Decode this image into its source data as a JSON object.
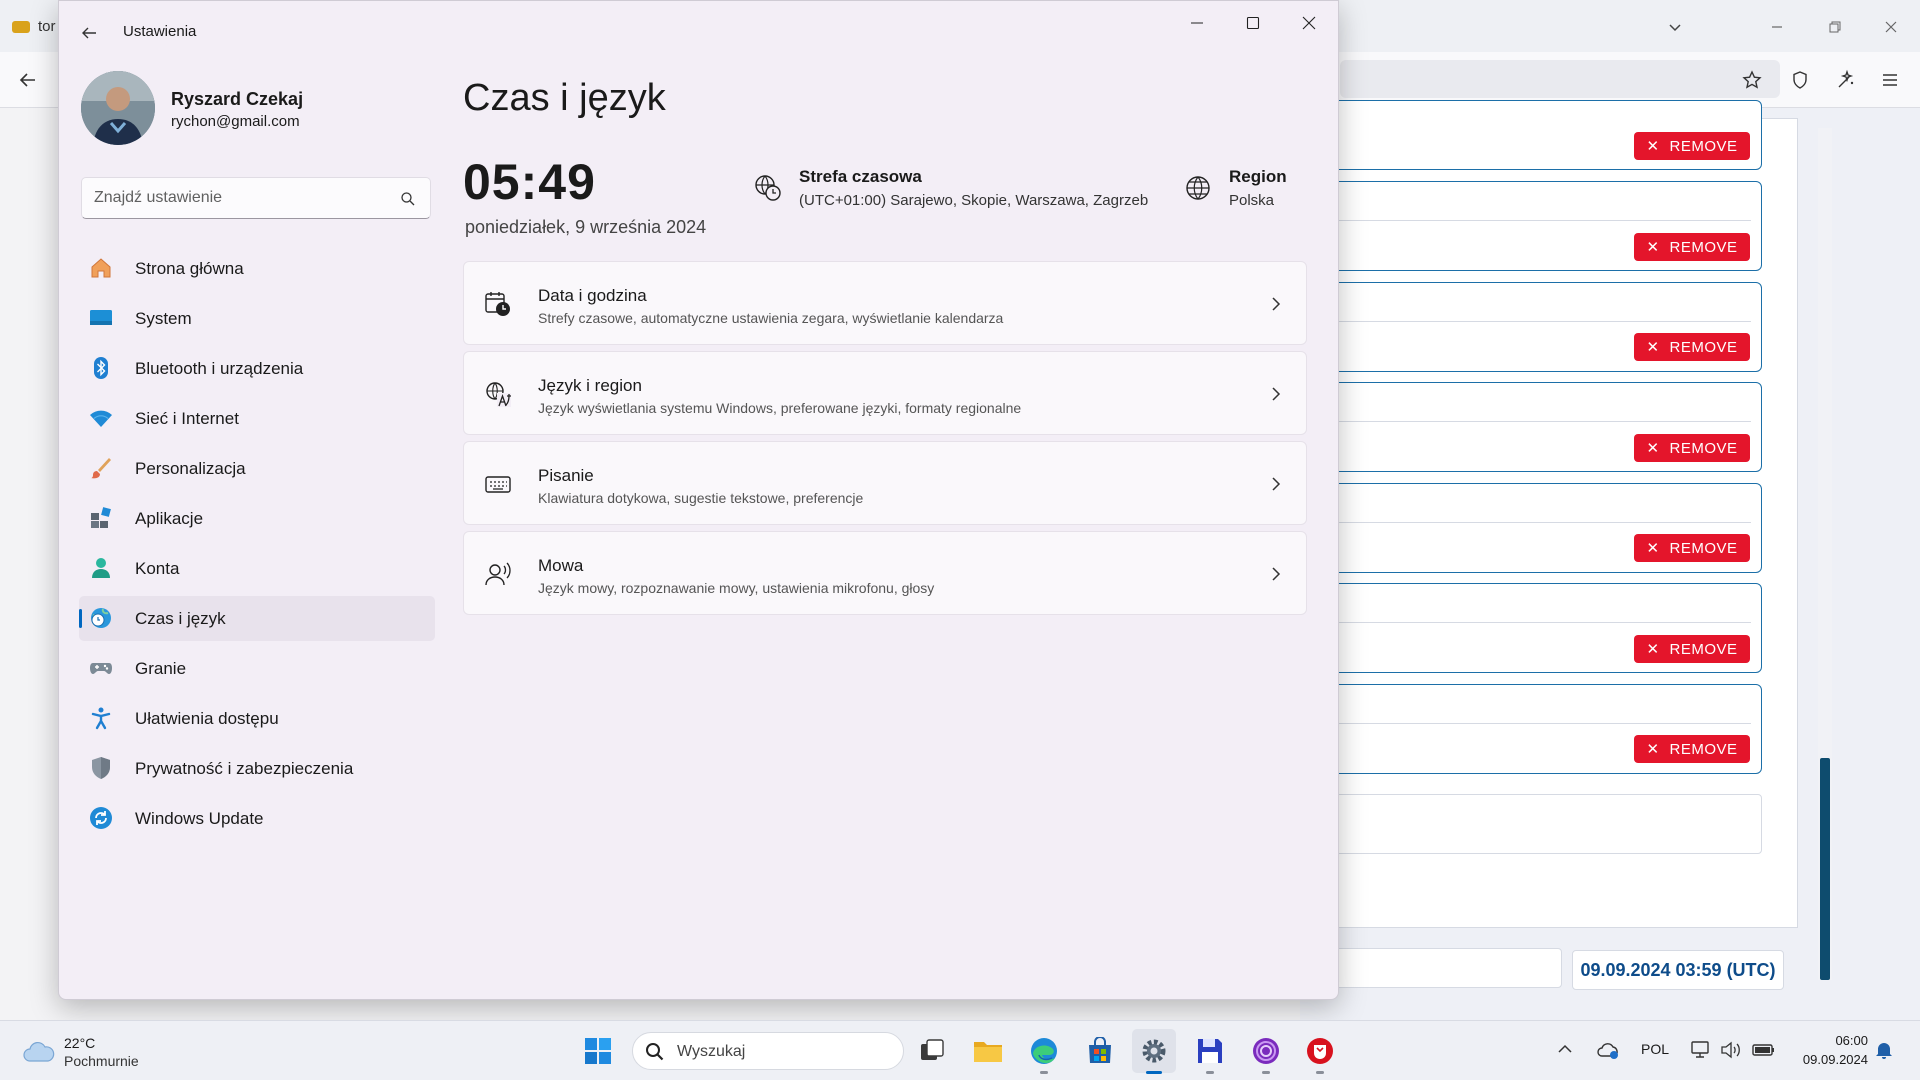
{
  "browser": {
    "tab_title": "tor",
    "remove_label": "REMOVE",
    "timestamp": "09.09.2024 03:59 (UTC)"
  },
  "settings": {
    "window_title": "Ustawienia",
    "user": {
      "name": "Ryszard Czekaj",
      "email": "rychon@gmail.com"
    },
    "search_placeholder": "Znajdź ustawienie",
    "nav": [
      {
        "label": "Strona główna",
        "icon": "home-icon",
        "active": false
      },
      {
        "label": "System",
        "icon": "monitor-icon",
        "active": false
      },
      {
        "label": "Bluetooth i urządzenia",
        "icon": "bluetooth-icon",
        "active": false
      },
      {
        "label": "Sieć i Internet",
        "icon": "wifi-icon",
        "active": false
      },
      {
        "label": "Personalizacja",
        "icon": "brush-icon",
        "active": false
      },
      {
        "label": "Aplikacje",
        "icon": "apps-icon",
        "active": false
      },
      {
        "label": "Konta",
        "icon": "person-icon",
        "active": false
      },
      {
        "label": "Czas i język",
        "icon": "globe-clock-icon",
        "active": true
      },
      {
        "label": "Granie",
        "icon": "gamepad-icon",
        "active": false
      },
      {
        "label": "Ułatwienia dostępu",
        "icon": "accessibility-icon",
        "active": false
      },
      {
        "label": "Prywatność i zabezpieczenia",
        "icon": "shield-icon",
        "active": false
      },
      {
        "label": "Windows Update",
        "icon": "update-icon",
        "active": false
      }
    ],
    "page_title": "Czas i język",
    "clock": "05:49",
    "date": "poniedziałek, 9 września 2024",
    "timezone": {
      "title": "Strefa czasowa",
      "value": "(UTC+01:00) Sarajewo, Skopie, Warszawa, Zagrzeb"
    },
    "region": {
      "title": "Region",
      "value": "Polska"
    },
    "cards": [
      {
        "title": "Data i godzina",
        "desc": "Strefy czasowe, automatyczne ustawienia zegara, wyświetlanie kalendarza",
        "icon": "calendar-clock-icon"
      },
      {
        "title": "Język i region",
        "desc": "Język wyświetlania systemu Windows, preferowane języki, formaty regionalne",
        "icon": "language-icon"
      },
      {
        "title": "Pisanie",
        "desc": "Klawiatura dotykowa, sugestie tekstowe, preferencje",
        "icon": "keyboard-icon"
      },
      {
        "title": "Mowa",
        "desc": "Język mowy, rozpoznawanie mowy, ustawienia mikrofonu, głosy",
        "icon": "speech-icon"
      }
    ]
  },
  "taskbar": {
    "weather": {
      "temp": "22°C",
      "desc": "Pochmurnie"
    },
    "search_placeholder": "Wyszukaj",
    "language": "POL",
    "time": "06:00",
    "date": "09.09.2024"
  },
  "colors": {
    "accent": "#0067c0",
    "remove": "#e4152b",
    "stamp": "#0e4c8a"
  }
}
